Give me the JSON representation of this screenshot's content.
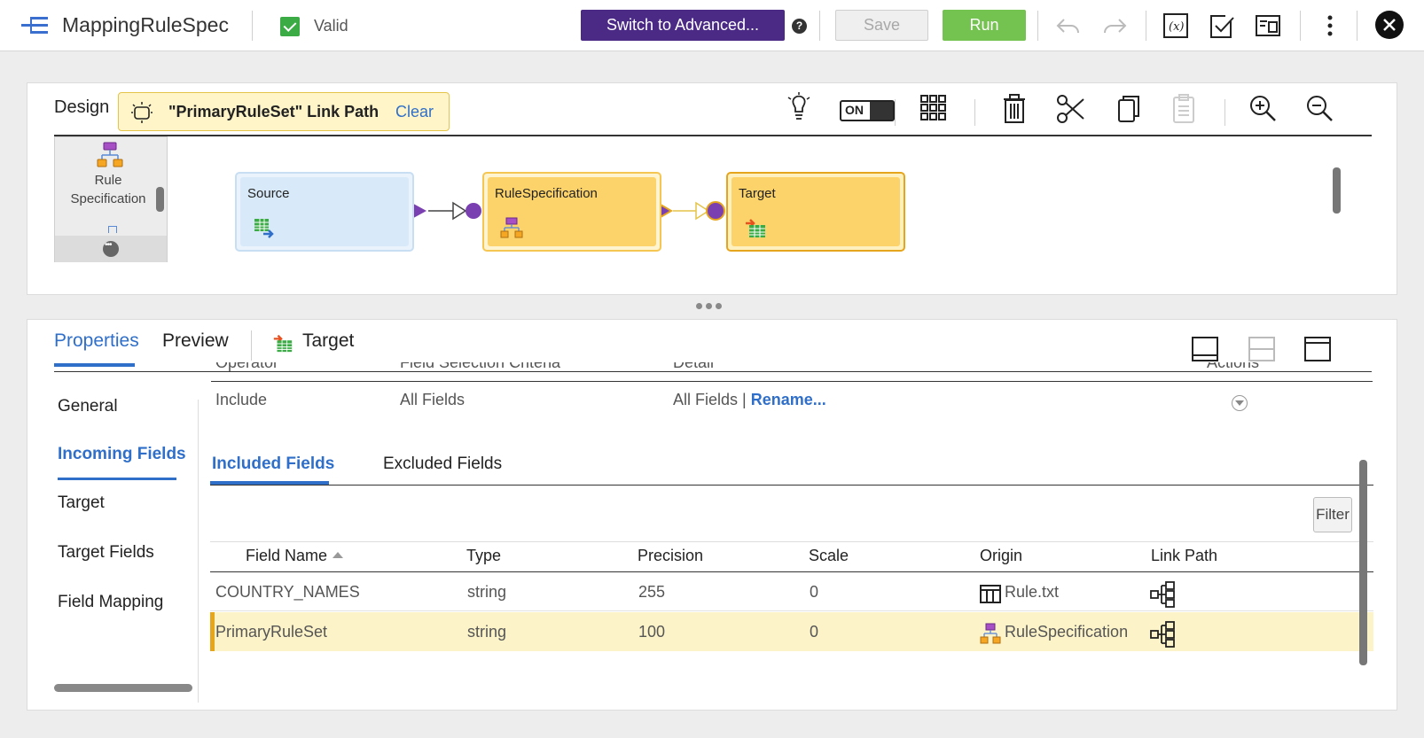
{
  "header": {
    "title": "MappingRuleSpec",
    "status_label": "Valid",
    "advanced_button": "Switch to Advanced...",
    "help_icon": "?",
    "save_button": "Save",
    "run_button": "Run",
    "colors": {
      "advanced": "#4b2a86",
      "run": "#74c24f",
      "valid": "#3bab46"
    }
  },
  "design": {
    "label": "Design",
    "link_path_banner": {
      "text": "\"PrimaryRuleSet\" Link Path",
      "clear": "Clear"
    },
    "toggle_label": "ON",
    "palette": {
      "item_label": "Rule Specification"
    },
    "nodes": [
      {
        "label": "Source",
        "icon": "source-table-icon"
      },
      {
        "label": "RuleSpecification",
        "icon": "rule-specification-icon"
      },
      {
        "label": "Target",
        "icon": "target-table-icon"
      }
    ]
  },
  "properties": {
    "tabs": {
      "properties": "Properties",
      "preview": "Preview"
    },
    "selected_object": "Target",
    "side_nav": [
      "General",
      "Incoming Fields",
      "Target",
      "Target Fields",
      "Field Mapping"
    ],
    "active_side_nav": "Incoming Fields",
    "rule_headers": [
      "Operator",
      "Field Selection Criteria",
      "Detail",
      "Actions"
    ],
    "rule_row": {
      "operator": "Include",
      "criteria": "All Fields",
      "detail": "All Fields",
      "separator": "|",
      "rename": "Rename..."
    },
    "subtabs": {
      "included": "Included Fields",
      "excluded": "Excluded Fields"
    },
    "filter_button": "Filter",
    "table": {
      "columns": [
        "Field Name",
        "Type",
        "Precision",
        "Scale",
        "Origin",
        "Link Path"
      ],
      "rows": [
        {
          "field_name": "COUNTRY_NAMES",
          "type": "string",
          "precision": "255",
          "scale": "0",
          "origin": "Rule.txt",
          "origin_icon": "flat-file-icon"
        },
        {
          "field_name": "PrimaryRuleSet",
          "type": "string",
          "precision": "100",
          "scale": "0",
          "origin": "RuleSpecification",
          "origin_icon": "rule-specification-icon",
          "highlighted": true
        }
      ]
    }
  }
}
